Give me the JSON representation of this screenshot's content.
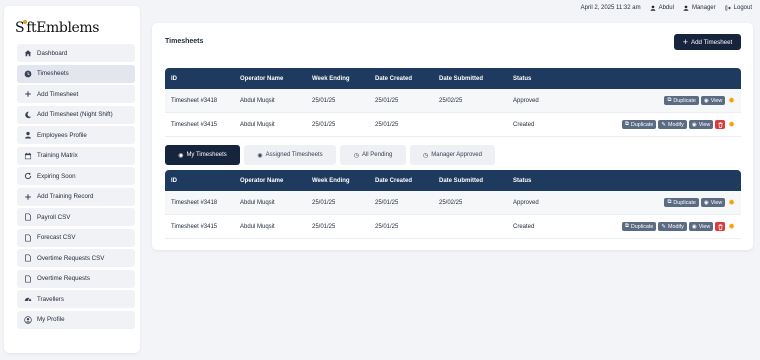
{
  "brand": {
    "logo_text_a": "S",
    "logo_text_b": "ftEmblems"
  },
  "topbar": {
    "date": "April 2, 2025 11:32 am",
    "user": "Abdul",
    "role": "Manager",
    "logout": "Logout"
  },
  "sidebar": {
    "items": [
      {
        "label": "Dashboard",
        "icon": "home-icon"
      },
      {
        "label": "Timesheets",
        "icon": "clock-icon",
        "active": true
      },
      {
        "label": "Add Timesheet",
        "icon": "plus-icon"
      },
      {
        "label": "Add Timesheet (Night Shift)",
        "icon": "moon-icon"
      },
      {
        "label": "Employees Profile",
        "icon": "user-icon"
      },
      {
        "label": "Training Matrix",
        "icon": "calendar-icon"
      },
      {
        "label": "Expiring Soon",
        "icon": "refresh-icon"
      },
      {
        "label": "Add Training Record",
        "icon": "plus-icon"
      },
      {
        "label": "Payroll CSV",
        "icon": "file-icon"
      },
      {
        "label": "Forecast CSV",
        "icon": "file-icon"
      },
      {
        "label": "Overtime Requests CSV",
        "icon": "file-icon"
      },
      {
        "label": "Overtime Requests",
        "icon": "file-icon"
      },
      {
        "label": "Travellers",
        "icon": "gauge-icon"
      },
      {
        "label": "My Profile",
        "icon": "user-circle-icon"
      }
    ]
  },
  "main": {
    "title": "Timesheets",
    "add_button": "Add Timesheet",
    "columns": [
      "ID",
      "Operator Name",
      "Week Ending",
      "Date Created",
      "Date Submitted",
      "Status"
    ],
    "buttons": {
      "duplicate": "Duplicate",
      "view": "View",
      "modify": "Modify"
    },
    "top_table": [
      {
        "id": "Timesheet #3418",
        "operator": "Abdul Muqsit",
        "week_ending": "25/01/25",
        "date_created": "25/01/25",
        "date_submitted": "25/02/25",
        "status": "Approved"
      },
      {
        "id": "Timesheet #3415",
        "operator": "Abdul Muqsit",
        "week_ending": "25/01/25",
        "date_created": "25/01/25",
        "date_submitted": "",
        "status": "Created"
      }
    ],
    "tabs": [
      {
        "label": "My Timesheets",
        "active": true
      },
      {
        "label": "Assigned Timesheets"
      },
      {
        "label": "All Pending"
      },
      {
        "label": "Manager Approved"
      }
    ],
    "bottom_table": [
      {
        "id": "Timesheet #3418",
        "operator": "Abdul Muqsit",
        "week_ending": "25/01/25",
        "date_created": "25/01/25",
        "date_submitted": "25/02/25",
        "status": "Approved"
      },
      {
        "id": "Timesheet #3415",
        "operator": "Abdul Muqsit",
        "week_ending": "25/01/25",
        "date_created": "25/01/25",
        "date_submitted": "",
        "status": "Created"
      }
    ]
  },
  "colors": {
    "primary": "#16253d",
    "table_header": "#1e3a5f",
    "delete": "#dc3b3b",
    "gear": "#f59e0b",
    "secondary_btn": "#5b6b83"
  }
}
